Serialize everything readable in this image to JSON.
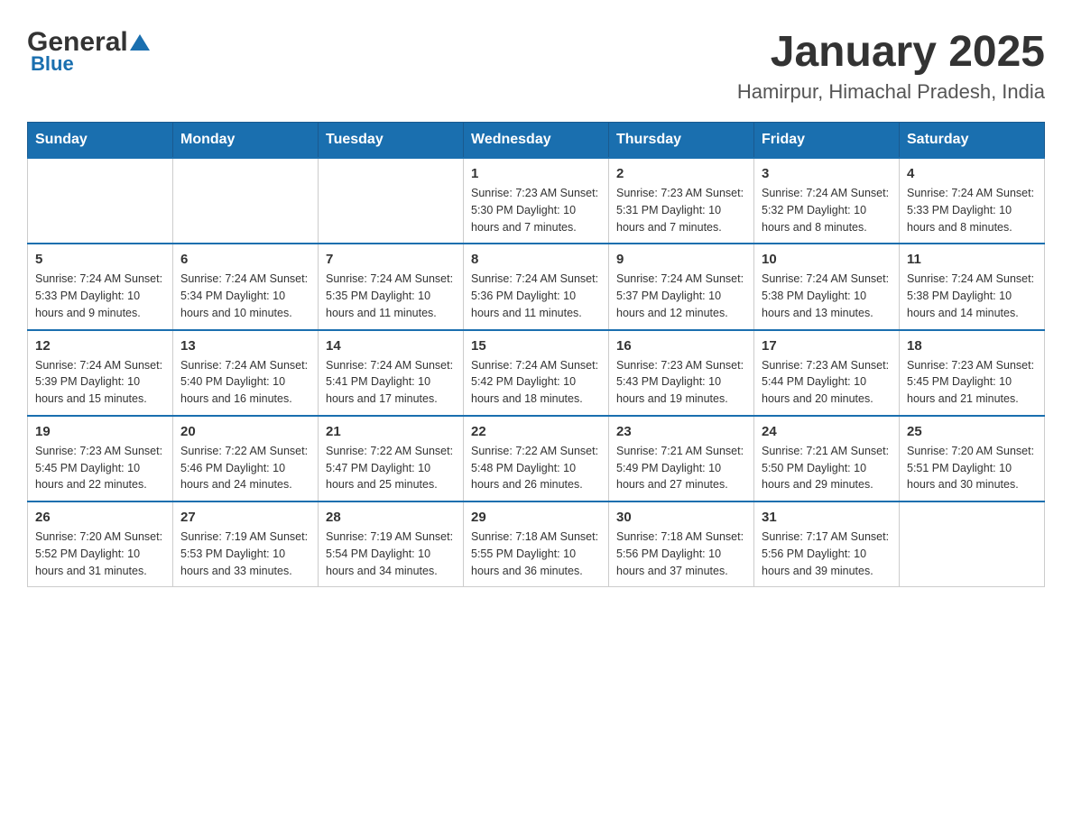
{
  "header": {
    "logo_general": "General",
    "logo_blue": "Blue",
    "month": "January 2025",
    "location": "Hamirpur, Himachal Pradesh, India"
  },
  "weekdays": [
    "Sunday",
    "Monday",
    "Tuesday",
    "Wednesday",
    "Thursday",
    "Friday",
    "Saturday"
  ],
  "weeks": [
    {
      "days": [
        {
          "date": "",
          "info": ""
        },
        {
          "date": "",
          "info": ""
        },
        {
          "date": "",
          "info": ""
        },
        {
          "date": "1",
          "info": "Sunrise: 7:23 AM\nSunset: 5:30 PM\nDaylight: 10 hours\nand 7 minutes."
        },
        {
          "date": "2",
          "info": "Sunrise: 7:23 AM\nSunset: 5:31 PM\nDaylight: 10 hours\nand 7 minutes."
        },
        {
          "date": "3",
          "info": "Sunrise: 7:24 AM\nSunset: 5:32 PM\nDaylight: 10 hours\nand 8 minutes."
        },
        {
          "date": "4",
          "info": "Sunrise: 7:24 AM\nSunset: 5:33 PM\nDaylight: 10 hours\nand 8 minutes."
        }
      ]
    },
    {
      "days": [
        {
          "date": "5",
          "info": "Sunrise: 7:24 AM\nSunset: 5:33 PM\nDaylight: 10 hours\nand 9 minutes."
        },
        {
          "date": "6",
          "info": "Sunrise: 7:24 AM\nSunset: 5:34 PM\nDaylight: 10 hours\nand 10 minutes."
        },
        {
          "date": "7",
          "info": "Sunrise: 7:24 AM\nSunset: 5:35 PM\nDaylight: 10 hours\nand 11 minutes."
        },
        {
          "date": "8",
          "info": "Sunrise: 7:24 AM\nSunset: 5:36 PM\nDaylight: 10 hours\nand 11 minutes."
        },
        {
          "date": "9",
          "info": "Sunrise: 7:24 AM\nSunset: 5:37 PM\nDaylight: 10 hours\nand 12 minutes."
        },
        {
          "date": "10",
          "info": "Sunrise: 7:24 AM\nSunset: 5:38 PM\nDaylight: 10 hours\nand 13 minutes."
        },
        {
          "date": "11",
          "info": "Sunrise: 7:24 AM\nSunset: 5:38 PM\nDaylight: 10 hours\nand 14 minutes."
        }
      ]
    },
    {
      "days": [
        {
          "date": "12",
          "info": "Sunrise: 7:24 AM\nSunset: 5:39 PM\nDaylight: 10 hours\nand 15 minutes."
        },
        {
          "date": "13",
          "info": "Sunrise: 7:24 AM\nSunset: 5:40 PM\nDaylight: 10 hours\nand 16 minutes."
        },
        {
          "date": "14",
          "info": "Sunrise: 7:24 AM\nSunset: 5:41 PM\nDaylight: 10 hours\nand 17 minutes."
        },
        {
          "date": "15",
          "info": "Sunrise: 7:24 AM\nSunset: 5:42 PM\nDaylight: 10 hours\nand 18 minutes."
        },
        {
          "date": "16",
          "info": "Sunrise: 7:23 AM\nSunset: 5:43 PM\nDaylight: 10 hours\nand 19 minutes."
        },
        {
          "date": "17",
          "info": "Sunrise: 7:23 AM\nSunset: 5:44 PM\nDaylight: 10 hours\nand 20 minutes."
        },
        {
          "date": "18",
          "info": "Sunrise: 7:23 AM\nSunset: 5:45 PM\nDaylight: 10 hours\nand 21 minutes."
        }
      ]
    },
    {
      "days": [
        {
          "date": "19",
          "info": "Sunrise: 7:23 AM\nSunset: 5:45 PM\nDaylight: 10 hours\nand 22 minutes."
        },
        {
          "date": "20",
          "info": "Sunrise: 7:22 AM\nSunset: 5:46 PM\nDaylight: 10 hours\nand 24 minutes."
        },
        {
          "date": "21",
          "info": "Sunrise: 7:22 AM\nSunset: 5:47 PM\nDaylight: 10 hours\nand 25 minutes."
        },
        {
          "date": "22",
          "info": "Sunrise: 7:22 AM\nSunset: 5:48 PM\nDaylight: 10 hours\nand 26 minutes."
        },
        {
          "date": "23",
          "info": "Sunrise: 7:21 AM\nSunset: 5:49 PM\nDaylight: 10 hours\nand 27 minutes."
        },
        {
          "date": "24",
          "info": "Sunrise: 7:21 AM\nSunset: 5:50 PM\nDaylight: 10 hours\nand 29 minutes."
        },
        {
          "date": "25",
          "info": "Sunrise: 7:20 AM\nSunset: 5:51 PM\nDaylight: 10 hours\nand 30 minutes."
        }
      ]
    },
    {
      "days": [
        {
          "date": "26",
          "info": "Sunrise: 7:20 AM\nSunset: 5:52 PM\nDaylight: 10 hours\nand 31 minutes."
        },
        {
          "date": "27",
          "info": "Sunrise: 7:19 AM\nSunset: 5:53 PM\nDaylight: 10 hours\nand 33 minutes."
        },
        {
          "date": "28",
          "info": "Sunrise: 7:19 AM\nSunset: 5:54 PM\nDaylight: 10 hours\nand 34 minutes."
        },
        {
          "date": "29",
          "info": "Sunrise: 7:18 AM\nSunset: 5:55 PM\nDaylight: 10 hours\nand 36 minutes."
        },
        {
          "date": "30",
          "info": "Sunrise: 7:18 AM\nSunset: 5:56 PM\nDaylight: 10 hours\nand 37 minutes."
        },
        {
          "date": "31",
          "info": "Sunrise: 7:17 AM\nSunset: 5:56 PM\nDaylight: 10 hours\nand 39 minutes."
        },
        {
          "date": "",
          "info": ""
        }
      ]
    }
  ]
}
